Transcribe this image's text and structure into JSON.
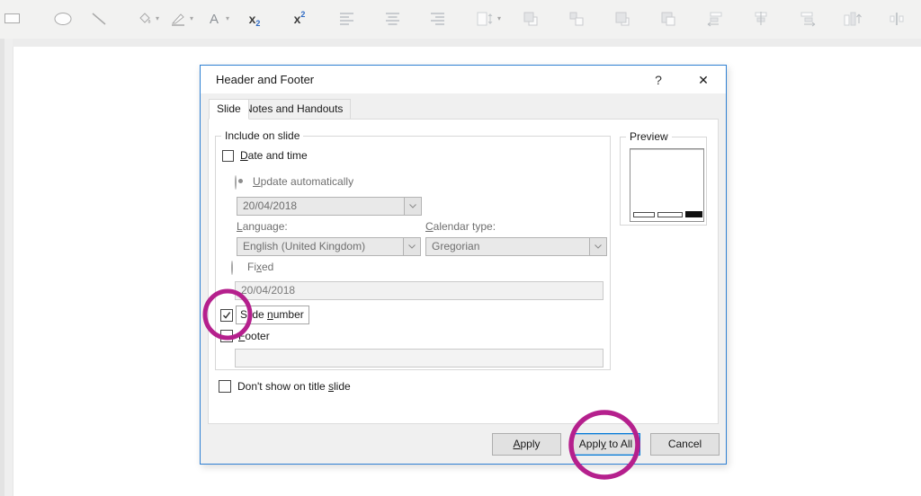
{
  "toolbar": {
    "icons": [
      "shape-rectangle",
      "shape-oval",
      "shape-line",
      "shape-fill",
      "shape-outline",
      "font-color",
      "subscript",
      "superscript",
      "align-text-left",
      "align-text-center",
      "align-text-right",
      "line-spacing",
      "bring-forward",
      "send-backward",
      "bring-to-front",
      "send-to-back",
      "align-objects-left",
      "align-objects-center",
      "align-objects-right",
      "rotate-objects",
      "distribute-objects"
    ],
    "subscript_x": "x",
    "subscript_n": "2",
    "superscript_x": "x",
    "superscript_n": "2"
  },
  "dialog": {
    "title": "Header and Footer",
    "help": "?",
    "close": "✕",
    "tabs": [
      {
        "label": "Slide"
      },
      {
        "label": "Notes and Handouts"
      }
    ],
    "include": {
      "legend": "Include on slide",
      "date_time": {
        "pre": "",
        "key": "D",
        "post": "ate and time"
      },
      "update_auto": {
        "pre": "",
        "key": "U",
        "post": "pdate automatically"
      },
      "date_value": "20/04/2018",
      "language_label": {
        "pre": "",
        "key": "L",
        "post": "anguage:"
      },
      "language_value": "English (United Kingdom)",
      "calendar_label": {
        "pre": "",
        "key": "C",
        "post": "alendar type:"
      },
      "calendar_value": "Gregorian",
      "fixed": {
        "pre": "Fi",
        "key": "x",
        "post": "ed"
      },
      "fixed_value": "20/04/2018",
      "slide_number": {
        "pre": "Slide ",
        "key": "n",
        "post": "umber"
      },
      "footer": {
        "pre": "",
        "key": "F",
        "post": "ooter"
      },
      "footer_value": ""
    },
    "dont_show": {
      "pre": "Don't show on title ",
      "key": "s",
      "post": "lide"
    },
    "preview_legend": "Preview",
    "buttons": {
      "apply": {
        "pre": "",
        "key": "A",
        "post": "pply"
      },
      "apply_to_all": {
        "pre": "Appl",
        "key": "y",
        "post": " to All"
      },
      "cancel": "Cancel"
    },
    "state": {
      "date_time_checked": false,
      "update_automatically_selected": true,
      "fixed_selected": false,
      "slide_number_checked": true,
      "footer_checked": false,
      "dont_show_checked": false
    }
  },
  "annotations": {
    "highlight_color": "#b5208d"
  }
}
